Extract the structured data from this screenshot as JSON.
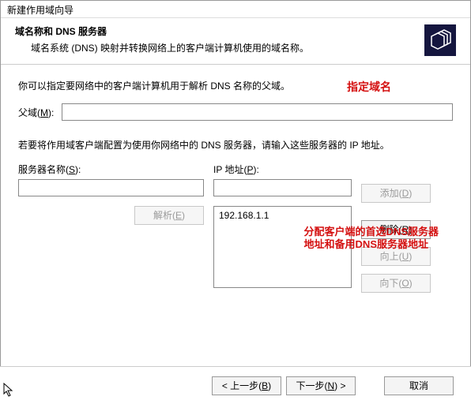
{
  "window": {
    "title": "新建作用域向导"
  },
  "header": {
    "title": "域名称和 DNS 服务器",
    "subtitle": "域名系统 (DNS) 映射并转换网络上的客户端计算机使用的域名称。"
  },
  "annotations": {
    "specify_domain": "指定域名",
    "dns_addr_line1": "分配客户端的首选DNS服务器",
    "dns_addr_line2": "地址和备用DNS服务器地址"
  },
  "content": {
    "intro": "你可以指定要网络中的客户端计算机用于解析 DNS 名称的父域。",
    "parent_domain_label": "父域(M):",
    "parent_domain_value": "",
    "dns_instruction": "若要将作用域客户端配置为使用你网络中的 DNS 服务器，请输入这些服务器的 IP 地址。",
    "server_name_label": "服务器名称(S):",
    "server_name_value": "",
    "ip_label": "IP 地址(P):",
    "ip_value": "",
    "resolve_label": "解析(E)",
    "ip_list": [
      "192.168.1.1"
    ],
    "btn_add": "添加(D)",
    "btn_remove": "删除(R)",
    "btn_up": "向上(U)",
    "btn_down": "向下(O)"
  },
  "footer": {
    "back": "< 上一步(B)",
    "next": "下一步(N) >",
    "cancel": "取消"
  }
}
